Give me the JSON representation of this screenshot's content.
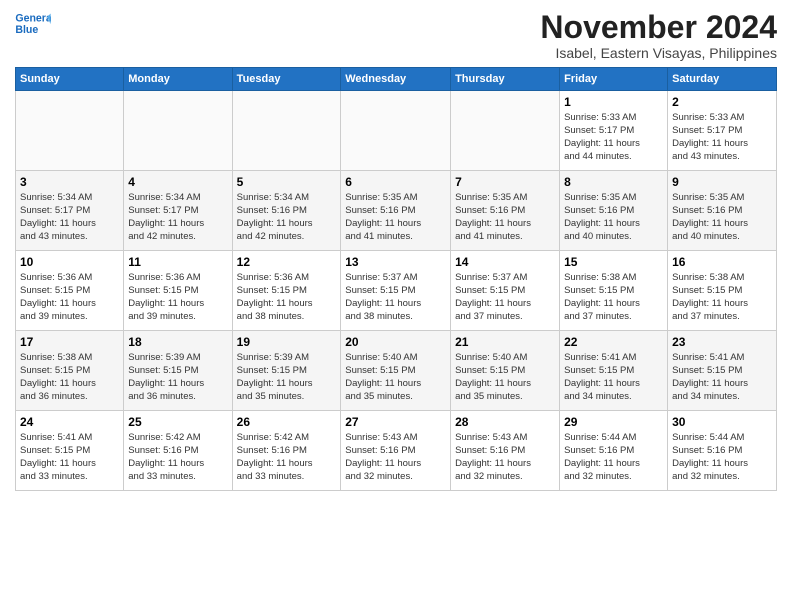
{
  "logo": {
    "line1": "General",
    "line2": "Blue"
  },
  "title": "November 2024",
  "subtitle": "Isabel, Eastern Visayas, Philippines",
  "days_header": [
    "Sunday",
    "Monday",
    "Tuesday",
    "Wednesday",
    "Thursday",
    "Friday",
    "Saturday"
  ],
  "weeks": [
    [
      {
        "num": "",
        "info": ""
      },
      {
        "num": "",
        "info": ""
      },
      {
        "num": "",
        "info": ""
      },
      {
        "num": "",
        "info": ""
      },
      {
        "num": "",
        "info": ""
      },
      {
        "num": "1",
        "info": "Sunrise: 5:33 AM\nSunset: 5:17 PM\nDaylight: 11 hours\nand 44 minutes."
      },
      {
        "num": "2",
        "info": "Sunrise: 5:33 AM\nSunset: 5:17 PM\nDaylight: 11 hours\nand 43 minutes."
      }
    ],
    [
      {
        "num": "3",
        "info": "Sunrise: 5:34 AM\nSunset: 5:17 PM\nDaylight: 11 hours\nand 43 minutes."
      },
      {
        "num": "4",
        "info": "Sunrise: 5:34 AM\nSunset: 5:17 PM\nDaylight: 11 hours\nand 42 minutes."
      },
      {
        "num": "5",
        "info": "Sunrise: 5:34 AM\nSunset: 5:16 PM\nDaylight: 11 hours\nand 42 minutes."
      },
      {
        "num": "6",
        "info": "Sunrise: 5:35 AM\nSunset: 5:16 PM\nDaylight: 11 hours\nand 41 minutes."
      },
      {
        "num": "7",
        "info": "Sunrise: 5:35 AM\nSunset: 5:16 PM\nDaylight: 11 hours\nand 41 minutes."
      },
      {
        "num": "8",
        "info": "Sunrise: 5:35 AM\nSunset: 5:16 PM\nDaylight: 11 hours\nand 40 minutes."
      },
      {
        "num": "9",
        "info": "Sunrise: 5:35 AM\nSunset: 5:16 PM\nDaylight: 11 hours\nand 40 minutes."
      }
    ],
    [
      {
        "num": "10",
        "info": "Sunrise: 5:36 AM\nSunset: 5:15 PM\nDaylight: 11 hours\nand 39 minutes."
      },
      {
        "num": "11",
        "info": "Sunrise: 5:36 AM\nSunset: 5:15 PM\nDaylight: 11 hours\nand 39 minutes."
      },
      {
        "num": "12",
        "info": "Sunrise: 5:36 AM\nSunset: 5:15 PM\nDaylight: 11 hours\nand 38 minutes."
      },
      {
        "num": "13",
        "info": "Sunrise: 5:37 AM\nSunset: 5:15 PM\nDaylight: 11 hours\nand 38 minutes."
      },
      {
        "num": "14",
        "info": "Sunrise: 5:37 AM\nSunset: 5:15 PM\nDaylight: 11 hours\nand 37 minutes."
      },
      {
        "num": "15",
        "info": "Sunrise: 5:38 AM\nSunset: 5:15 PM\nDaylight: 11 hours\nand 37 minutes."
      },
      {
        "num": "16",
        "info": "Sunrise: 5:38 AM\nSunset: 5:15 PM\nDaylight: 11 hours\nand 37 minutes."
      }
    ],
    [
      {
        "num": "17",
        "info": "Sunrise: 5:38 AM\nSunset: 5:15 PM\nDaylight: 11 hours\nand 36 minutes."
      },
      {
        "num": "18",
        "info": "Sunrise: 5:39 AM\nSunset: 5:15 PM\nDaylight: 11 hours\nand 36 minutes."
      },
      {
        "num": "19",
        "info": "Sunrise: 5:39 AM\nSunset: 5:15 PM\nDaylight: 11 hours\nand 35 minutes."
      },
      {
        "num": "20",
        "info": "Sunrise: 5:40 AM\nSunset: 5:15 PM\nDaylight: 11 hours\nand 35 minutes."
      },
      {
        "num": "21",
        "info": "Sunrise: 5:40 AM\nSunset: 5:15 PM\nDaylight: 11 hours\nand 35 minutes."
      },
      {
        "num": "22",
        "info": "Sunrise: 5:41 AM\nSunset: 5:15 PM\nDaylight: 11 hours\nand 34 minutes."
      },
      {
        "num": "23",
        "info": "Sunrise: 5:41 AM\nSunset: 5:15 PM\nDaylight: 11 hours\nand 34 minutes."
      }
    ],
    [
      {
        "num": "24",
        "info": "Sunrise: 5:41 AM\nSunset: 5:15 PM\nDaylight: 11 hours\nand 33 minutes."
      },
      {
        "num": "25",
        "info": "Sunrise: 5:42 AM\nSunset: 5:16 PM\nDaylight: 11 hours\nand 33 minutes."
      },
      {
        "num": "26",
        "info": "Sunrise: 5:42 AM\nSunset: 5:16 PM\nDaylight: 11 hours\nand 33 minutes."
      },
      {
        "num": "27",
        "info": "Sunrise: 5:43 AM\nSunset: 5:16 PM\nDaylight: 11 hours\nand 32 minutes."
      },
      {
        "num": "28",
        "info": "Sunrise: 5:43 AM\nSunset: 5:16 PM\nDaylight: 11 hours\nand 32 minutes."
      },
      {
        "num": "29",
        "info": "Sunrise: 5:44 AM\nSunset: 5:16 PM\nDaylight: 11 hours\nand 32 minutes."
      },
      {
        "num": "30",
        "info": "Sunrise: 5:44 AM\nSunset: 5:16 PM\nDaylight: 11 hours\nand 32 minutes."
      }
    ]
  ]
}
